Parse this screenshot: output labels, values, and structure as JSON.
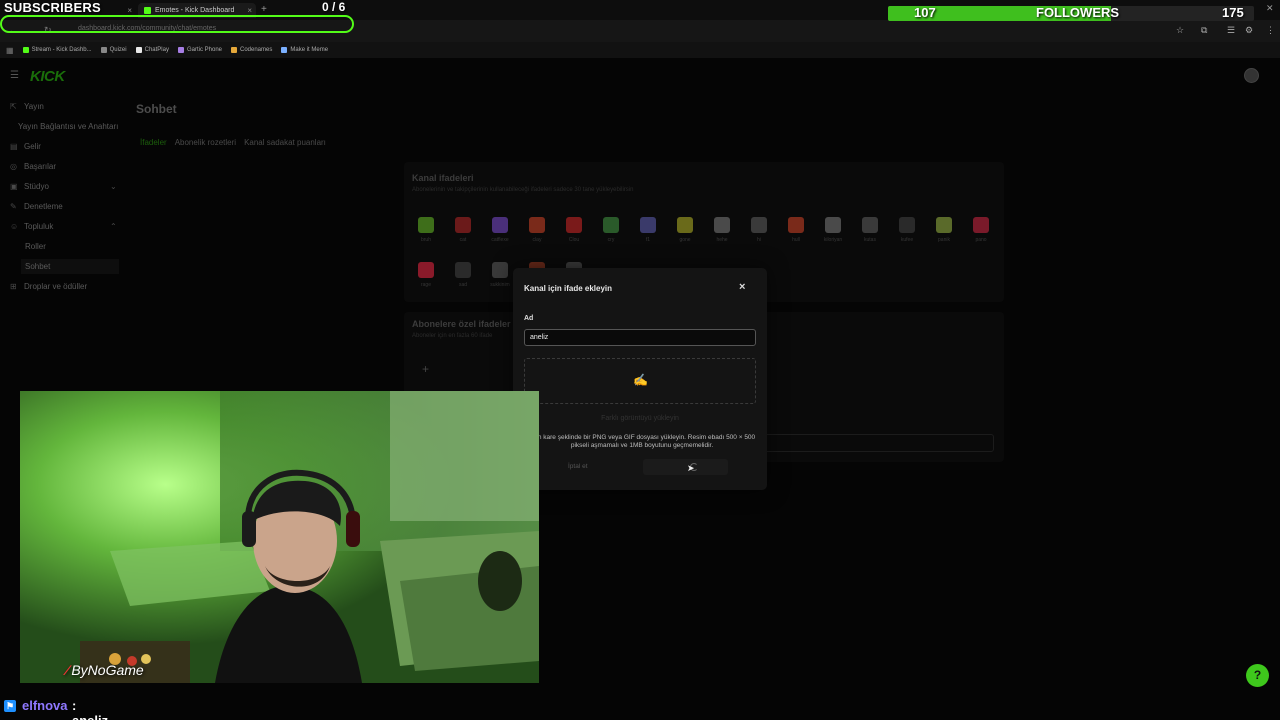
{
  "overlay": {
    "subscribers_label": "SUBSCRIBERS",
    "subscribers_count": "0 / 6",
    "followers_count": "107",
    "followers_label": "FOLLOWERS",
    "followers_goal": "175",
    "followers_progress": 0.61,
    "accent_color": "#53fc18"
  },
  "browser": {
    "tabs": [
      {
        "label": "New tab"
      },
      {
        "label": "Emotes - Kick Dashboard"
      }
    ],
    "url": "dashboard.kick.com/community/chat/emotes",
    "bookmarks": [
      "Stream - Kick Dashb...",
      "Quizei",
      "ChatPlay",
      "Gartic Phone",
      "Codenames",
      "Make it Meme"
    ],
    "icons": [
      "star-icon",
      "extensions-icon",
      "profile-icon"
    ]
  },
  "dashboard": {
    "logo": "KICK",
    "sidebar": {
      "items": [
        {
          "label": "Yayın",
          "icon": "broadcast-icon"
        },
        {
          "label": "Yayın Bağlantısı ve Anahtarı",
          "icon": ""
        },
        {
          "label": "Gelir",
          "icon": "money-icon"
        },
        {
          "label": "Başarılar",
          "icon": "achievement-icon"
        },
        {
          "label": "Stüdyo",
          "icon": "studio-icon"
        },
        {
          "label": "Denetleme",
          "icon": "moderation-icon"
        },
        {
          "label": "Topluluk",
          "icon": "community-icon"
        },
        {
          "label": "Roller",
          "icon": ""
        },
        {
          "label": "Sohbet",
          "icon": ""
        },
        {
          "label": "Droplar ve ödüller",
          "icon": "drops-icon"
        }
      ]
    },
    "page_title": "Sohbet",
    "subtabs": [
      "İfadeler",
      "Abonelik rozetleri",
      "Kanal sadakat puanları"
    ],
    "channel_emotes": {
      "title": "Kanal ifadeleri",
      "description": "Abonelerinin ve takipçilerinin kullanabileceği ifadeleri sadece 30 tane yükleyebilirsin",
      "emotes": [
        {
          "name": "bruh",
          "color": "#3e6e1a"
        },
        {
          "name": "cat",
          "color": "#6b1a1a"
        },
        {
          "name": "catflexe",
          "color": "#4a2f7a"
        },
        {
          "name": "clay",
          "color": "#7a2a1a"
        },
        {
          "name": "Clou",
          "color": "#7a1a1a"
        },
        {
          "name": "cry",
          "color": "#2a5a2a"
        },
        {
          "name": "f1",
          "color": "#3a3a6a"
        },
        {
          "name": "gone",
          "color": "#6a6a1a"
        },
        {
          "name": "hehe",
          "color": "#4a4a4a"
        },
        {
          "name": "hi",
          "color": "#3a3a3a"
        },
        {
          "name": "hull",
          "color": "#7a2a1a"
        },
        {
          "name": "kiloriyan",
          "color": "#4a4a4a"
        },
        {
          "name": "kutas",
          "color": "#3a3a3a"
        },
        {
          "name": "kufee",
          "color": "#2a2a2a"
        },
        {
          "name": "panik",
          "color": "#5a6a2a"
        },
        {
          "name": "pano",
          "color": "#7a1a2a"
        },
        {
          "name": "rage",
          "color": "#8a1a2a"
        },
        {
          "name": "sad",
          "color": "#2a2a2a"
        },
        {
          "name": "sukkinim",
          "color": "#3a3a3a"
        },
        {
          "name": "",
          "color": "#6a2a1a"
        },
        {
          "name": "",
          "color": "#3a3a3a"
        }
      ]
    },
    "sub_emotes": {
      "title": "Abonelere özel ifadeler",
      "description": "Aboneler için en fazla 60 ifade",
      "add_label": "+"
    }
  },
  "modal": {
    "title": "Kanal için ifade ekleyin",
    "close_label": "×",
    "field_label": "Ad",
    "field_value": "aneliz",
    "dropzone_icon": "✍",
    "faded_text": "Farklı görüntüyü yükleyin",
    "help_text": "...en kare şeklinde bir PNG veya GIF dosyası yükleyin. Resim ebadı 500 × 500 pikseli aşmamalı ve 1MB boyutunu geçmemelidir.",
    "cancel_label": "İptal et"
  },
  "webcam": {
    "logo_text": "ByNoGame"
  },
  "chat_ticker": {
    "username": "elfnova",
    "separator": ":",
    "message": "aneliz",
    "user_color": "#8f78ff"
  }
}
